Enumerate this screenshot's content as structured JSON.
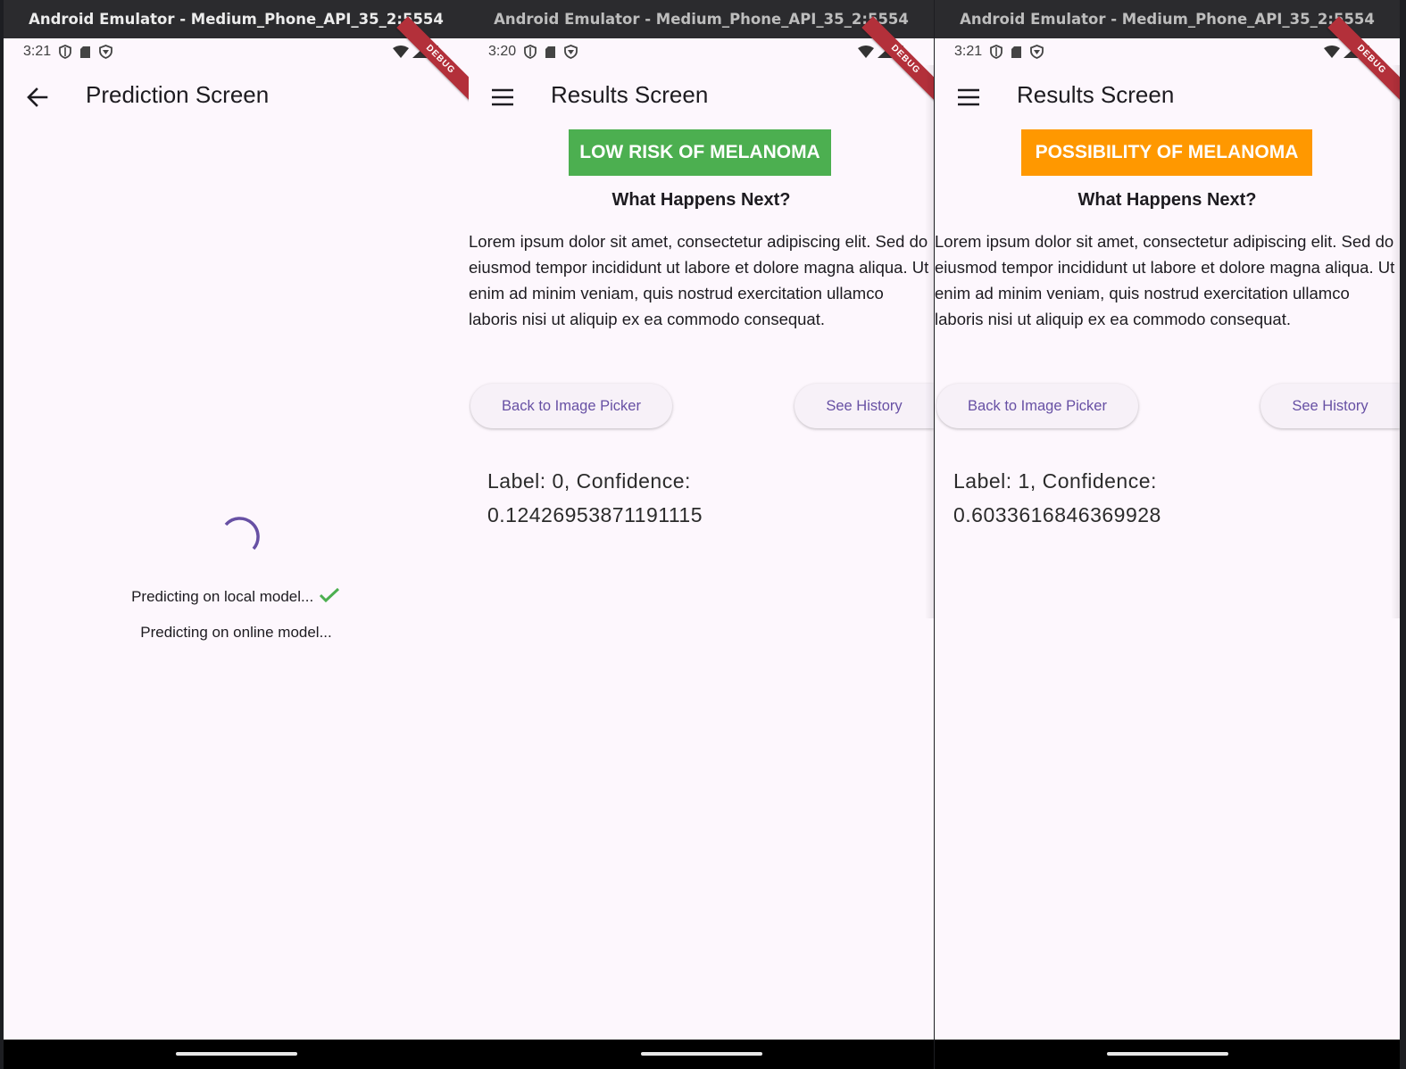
{
  "colors": {
    "background": "#fdf7fd",
    "accent": "#6750a4",
    "low_risk": "#4caf50",
    "possible": "#ff9800",
    "check": "#4caf50"
  },
  "screens": [
    {
      "window_title": "Android Emulator - Medium_Phone_API_35_2:5554",
      "status_time": "3:21",
      "debug_label": "DEBUG",
      "appbar": {
        "icon": "back-arrow-icon",
        "title": "Prediction Screen"
      },
      "progress": {
        "local_label": "Predicting on local model...",
        "local_done": true,
        "online_label": "Predicting on online model..."
      }
    },
    {
      "window_title": "Android Emulator - Medium_Phone_API_35_2:5554",
      "status_time": "3:20",
      "debug_label": "DEBUG",
      "appbar": {
        "icon": "menu-icon",
        "title": "Results Screen"
      },
      "banner": "LOW RISK OF MELANOMA",
      "heading": "What Happens Next?",
      "body": "Lorem ipsum dolor sit amet, consectetur adipiscing elit. Sed do eiusmod tempor incididunt ut labore et dolore magna aliqua. Ut enim ad minim veniam, quis nostrud exercitation ullamco laboris nisi ut aliquip ex ea commodo consequat.",
      "buttons": {
        "back": "Back to Image Picker",
        "history": "See History"
      },
      "label_line1": "Label: 0, Confidence:",
      "label_line2": "0.12426953871191115"
    },
    {
      "window_title": "Android Emulator - Medium_Phone_API_35_2:5554",
      "status_time": "3:21",
      "debug_label": "DEBUG",
      "appbar": {
        "icon": "menu-icon",
        "title": "Results Screen"
      },
      "banner": "POSSIBILITY OF MELANOMA",
      "heading": "What Happens Next?",
      "body": "Lorem ipsum dolor sit amet, consectetur adipiscing elit. Sed do eiusmod tempor incididunt ut labore et dolore magna aliqua. Ut enim ad minim veniam, quis nostrud exercitation ullamco laboris nisi ut aliquip ex ea commodo consequat.",
      "buttons": {
        "back": "Back to Image Picker",
        "history": "See History"
      },
      "label_line1": "Label: 1, Confidence:",
      "label_line2": "0.6033616846369928"
    }
  ]
}
